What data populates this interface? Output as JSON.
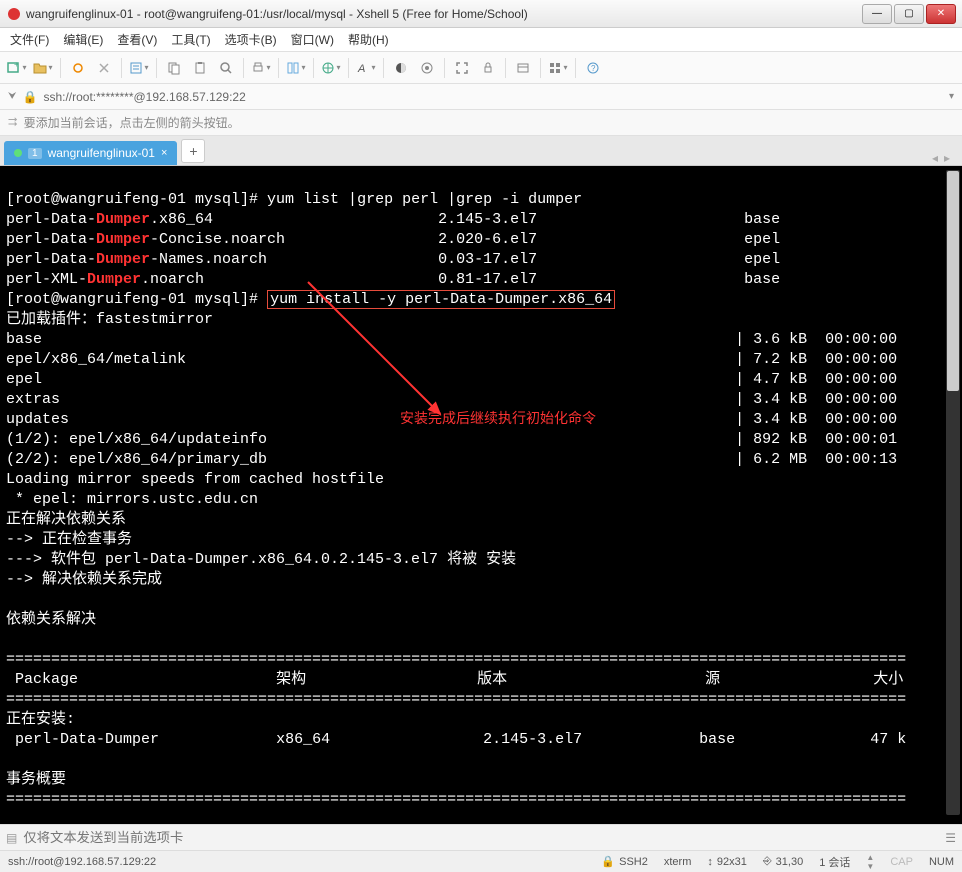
{
  "window": {
    "title": "wangruifenglinux-01 - root@wangruifeng-01:/usr/local/mysql - Xshell 5 (Free for Home/School)"
  },
  "menu": {
    "file": "文件(F)",
    "edit": "编辑(E)",
    "view": "查看(V)",
    "tools": "工具(T)",
    "tabs": "选项卡(B)",
    "window": "窗口(W)",
    "help": "帮助(H)"
  },
  "address": "ssh://root:********@192.168.57.129:22",
  "hint": "要添加当前会话，点击左侧的箭头按钮。",
  "tab": {
    "index": "1",
    "name": "wangruifenglinux-01"
  },
  "terminal": {
    "prompt": "[root@wangruifeng-01 mysql]#",
    "cmd1": " yum list |grep perl |grep -i dumper",
    "pkg1a": "perl-Data-",
    "pkg1b": "Dumper",
    "pkg1c": ".x86_64",
    "pkg1v": "2.145-3.el7",
    "pkg1r": "base",
    "pkg2c": "-Concise.noarch",
    "pkg2v": "2.020-6.el7",
    "pkg2r": "epel",
    "pkg3c": "-Names.noarch",
    "pkg3v": "0.03-17.el7",
    "pkg3r": "epel",
    "pkg4a": "perl-XML-",
    "pkg4c": ".noarch",
    "pkg4v": "0.81-17.el7",
    "pkg4r": "base",
    "cmd2": "yum install -y perl-Data-Dumper.x86_64",
    "loaded": "已加载插件：fastestmirror",
    "l_base": "base",
    "l_base_s": "| 3.6 kB  00:00:00",
    "l_epel_m": "epel/x86_64/metalink",
    "l_epel_m_s": "| 7.2 kB  00:00:00",
    "l_epel": "epel",
    "l_epel_s": "| 4.7 kB  00:00:00",
    "l_extras": "extras",
    "l_extras_s": "| 3.4 kB  00:00:00",
    "l_updates": "updates",
    "l_updates_s": "| 3.4 kB  00:00:00",
    "l_u1": "(1/2): epel/x86_64/updateinfo",
    "l_u1_s": "| 892 kB  00:00:01",
    "l_u2": "(2/2): epel/x86_64/primary_db",
    "l_u2_s": "| 6.2 MB  00:00:13",
    "mirror1": "Loading mirror speeds from cached hostfile",
    "mirror2": " * epel: mirrors.ustc.edu.cn",
    "dep1": "正在解决依赖关系",
    "dep2": "--> 正在检查事务",
    "dep3": "---> 软件包 perl-Data-Dumper.x86_64.0.2.145-3.el7 将被 安装",
    "dep4": "--> 解决依赖关系完成",
    "dep5": "依赖关系解决",
    "hdr_pkg": " Package",
    "hdr_arch": "架构",
    "hdr_ver": "版本",
    "hdr_src": "源",
    "hdr_size": "大小",
    "installing": "正在安装:",
    "inst_pkg": " perl-Data-Dumper",
    "inst_arch": "x86_64",
    "inst_ver": "2.145-3.el7",
    "inst_src": "base",
    "inst_size": "47 k",
    "summary": "事务概要",
    "annotation": "安装完成后继续执行初始化命令"
  },
  "sendbar": {
    "placeholder": "仅将文本发送到当前选项卡"
  },
  "status": {
    "conn": "ssh://root@192.168.57.129:22",
    "ssh": "SSH2",
    "term": "xterm",
    "size": "92x31",
    "pos": "31,30",
    "sess": "1 会话",
    "cap": "CAP",
    "num": "NUM"
  }
}
